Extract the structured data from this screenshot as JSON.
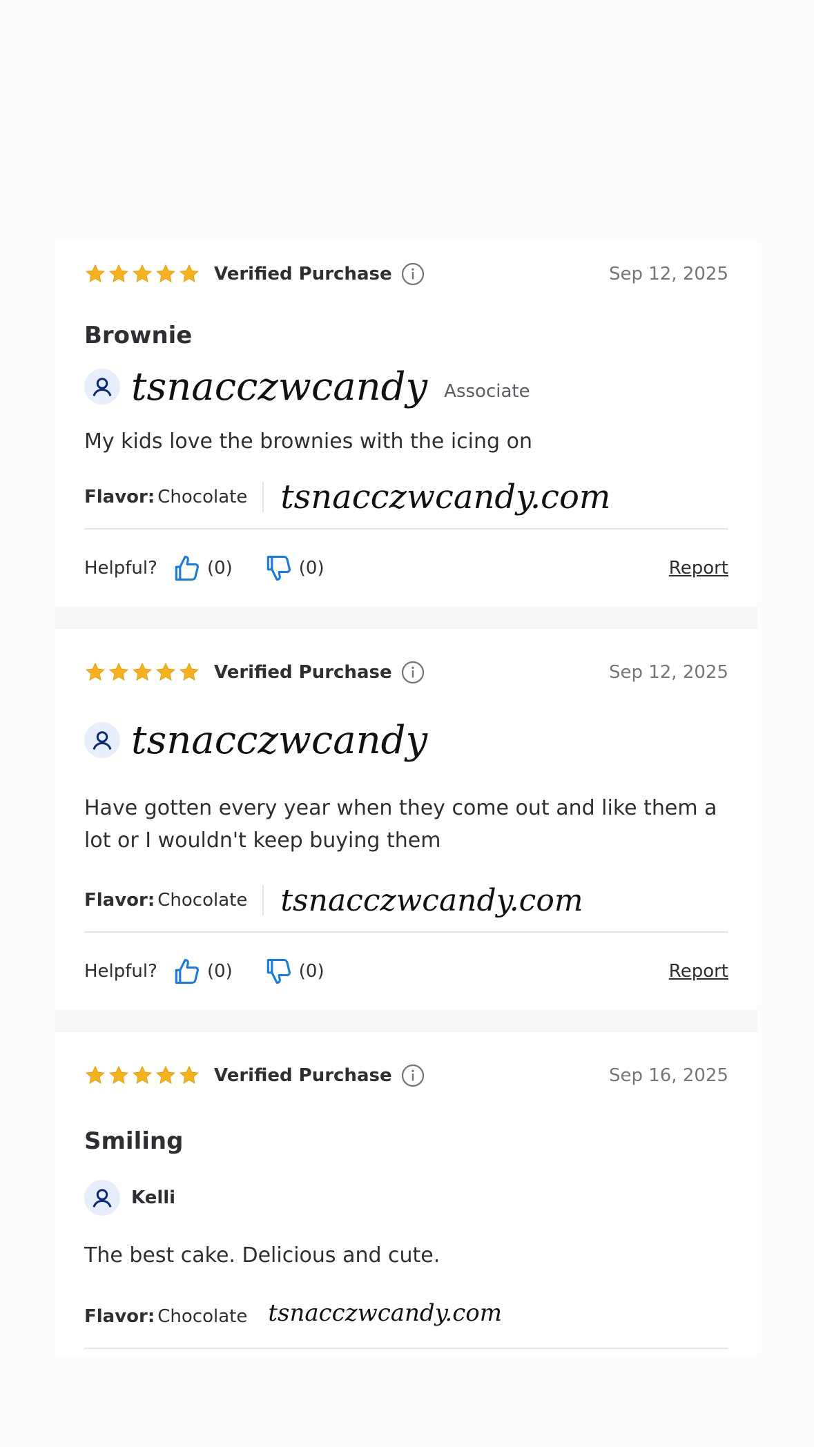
{
  "reviews": [
    {
      "rating": 5,
      "verified_label": "Verified Purchase",
      "date": "Sep 12, 2025",
      "title": "Brownie",
      "username": "tsnacczwcandy",
      "badge": "Associate",
      "body": "My kids love the brownies with the icing on",
      "flavor_label": "Flavor:",
      "flavor_value": "Chocolate",
      "watermark": "tsnacczwcandy.com",
      "helpful_label": "Helpful?",
      "helpful_yes": "(0)",
      "helpful_no": "(0)",
      "report_label": "Report"
    },
    {
      "rating": 5,
      "verified_label": "Verified Purchase",
      "date": "Sep 12, 2025",
      "username": "tsnacczwcandy",
      "body": "Have gotten every year when they come out and like them a lot or I wouldn't keep buying them",
      "flavor_label": "Flavor:",
      "flavor_value": "Chocolate",
      "watermark": "tsnacczwcandy.com",
      "helpful_label": "Helpful?",
      "helpful_yes": "(0)",
      "helpful_no": "(0)",
      "report_label": "Report"
    },
    {
      "rating": 5,
      "verified_label": "Verified Purchase",
      "date": "Sep 16, 2025",
      "title": "Smiling",
      "username": "Kelli",
      "body": "The best cake. Delicious and cute.",
      "flavor_label": "Flavor:",
      "flavor_value": "Chocolate",
      "watermark": "tsnacczwcandy.com"
    }
  ],
  "colors": {
    "star": "#f5b120",
    "thumb": "#1d7ad9",
    "avatar_bg": "#e7eefb",
    "avatar_icon": "#0b2a6f"
  },
  "icons": {
    "star": "star-icon",
    "info": "info-icon",
    "thumbs_up": "thumbs-up-icon",
    "thumbs_down": "thumbs-down-icon",
    "user": "user-avatar-icon"
  }
}
